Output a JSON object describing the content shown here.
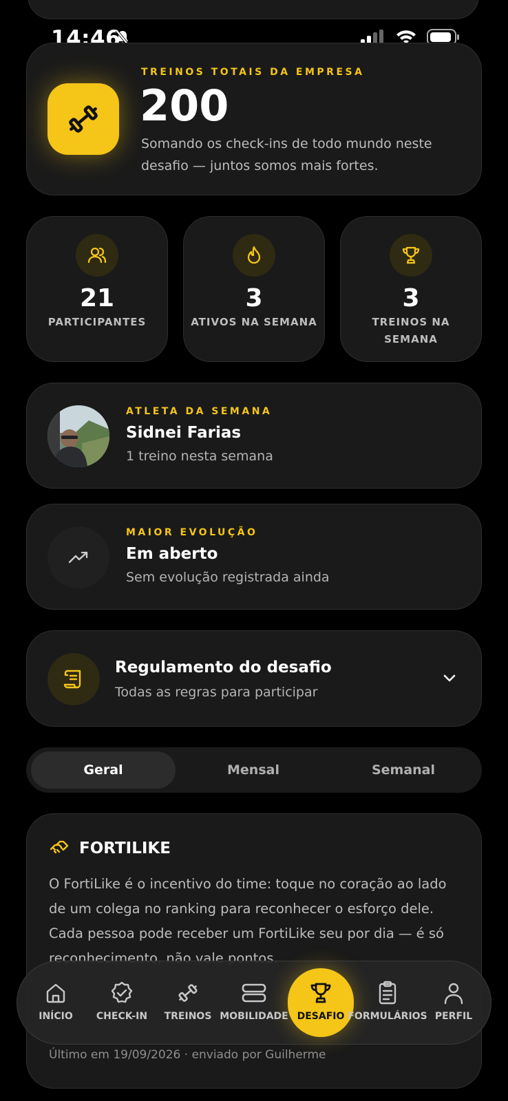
{
  "status_bar": {
    "time": "14:46"
  },
  "totals": {
    "eyebrow": "TREINOS TOTAIS DA EMPRESA",
    "value": "200",
    "description": "Somando os check-ins de todo mundo neste desafio — juntos somos mais fortes."
  },
  "stats": [
    {
      "value": "21",
      "label": "PARTICIPANTES",
      "icon": "users-icon"
    },
    {
      "value": "3",
      "label": "ATIVOS NA SEMANA",
      "icon": "flame-icon"
    },
    {
      "value": "3",
      "label": "TREINOS NA SEMANA",
      "icon": "trophy-icon"
    }
  ],
  "athlete": {
    "eyebrow": "ATLETA DA SEMANA",
    "name": "Sidnei Farias",
    "detail": "1 treino nesta semana"
  },
  "evolution": {
    "eyebrow": "MAIOR EVOLUÇÃO",
    "title": "Em aberto",
    "detail": "Sem evolução registrada ainda"
  },
  "rules": {
    "title": "Regulamento do desafio",
    "subtitle": "Todas as regras para participar"
  },
  "tabs": [
    "Geral",
    "Mensal",
    "Semanal"
  ],
  "active_tab": "Geral",
  "fortilike": {
    "title": "FORTILIKE",
    "body": "O FortiLike é o incentivo do time: toque no coração ao lado de um colega no ranking para reconhecer o esforço dele. Cada pessoa pode receber um FortiLike seu por dia — é só reconhecimento, não vale pontos.",
    "footer": "Último em 19/09/2026 · enviado por Guilherme"
  },
  "nav": {
    "items": [
      {
        "label": "INÍCIO",
        "icon": "home-icon"
      },
      {
        "label": "CHECK-IN",
        "icon": "check-badge-icon"
      },
      {
        "label": "TREINOS",
        "icon": "dumbbell-icon"
      },
      {
        "label": "MOBILIDADE",
        "icon": "stack-icon"
      },
      {
        "label": "DESAFIO",
        "icon": "trophy-icon"
      },
      {
        "label": "FORMULÁRIOS",
        "icon": "clipboard-icon"
      },
      {
        "label": "PERFIL",
        "icon": "person-icon"
      }
    ],
    "active": "DESAFIO"
  },
  "colors": {
    "accent": "#f5c518",
    "card": "#1a1a1a",
    "background": "#000000"
  }
}
